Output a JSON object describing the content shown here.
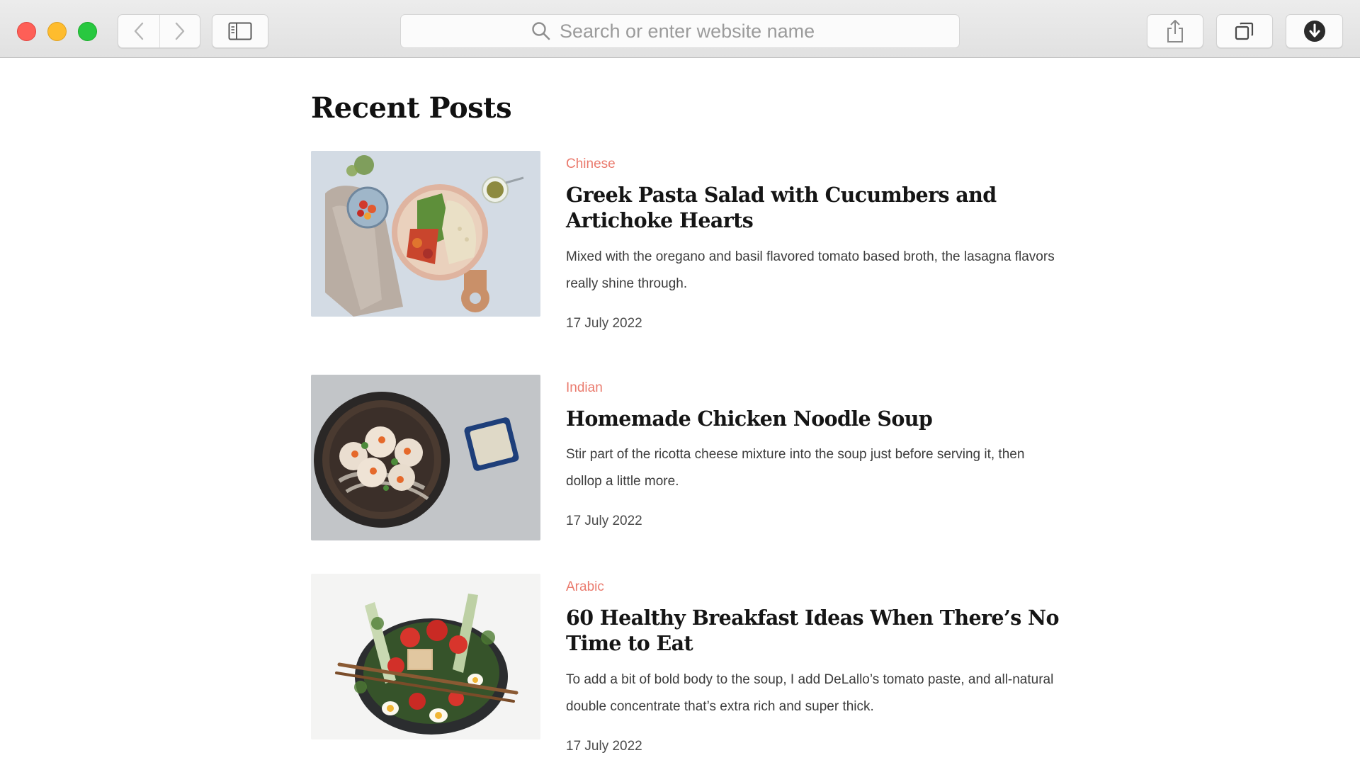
{
  "browser": {
    "search_placeholder": "Search or enter website name",
    "accent_close": "#fe5f57",
    "accent_minimize": "#febc2e",
    "accent_zoom": "#28c840"
  },
  "page": {
    "title": "Recent Posts",
    "category_color": "#ea7a6d"
  },
  "posts": [
    {
      "category": "Chinese",
      "title": "Greek Pasta Salad with Cucumbers and Artichoke Hearts",
      "excerpt": "Mixed with the oregano and basil flavored tomato based broth, the lasagna flavors really shine through.",
      "date": "17 July 2022"
    },
    {
      "category": "Indian",
      "title": "Homemade Chicken Noodle Soup",
      "excerpt": "Stir part of the ricotta cheese mixture into the soup just before serving it, then dollop a little more.",
      "date": "17 July 2022"
    },
    {
      "category": "Arabic",
      "title": "60 Healthy Breakfast Ideas When There’s No Time to Eat",
      "excerpt": "To add a bit of bold body to the soup, I add DeLallo’s tomato paste, and all-natural double concentrate that’s extra rich and super thick.",
      "date": "17 July 2022"
    }
  ]
}
